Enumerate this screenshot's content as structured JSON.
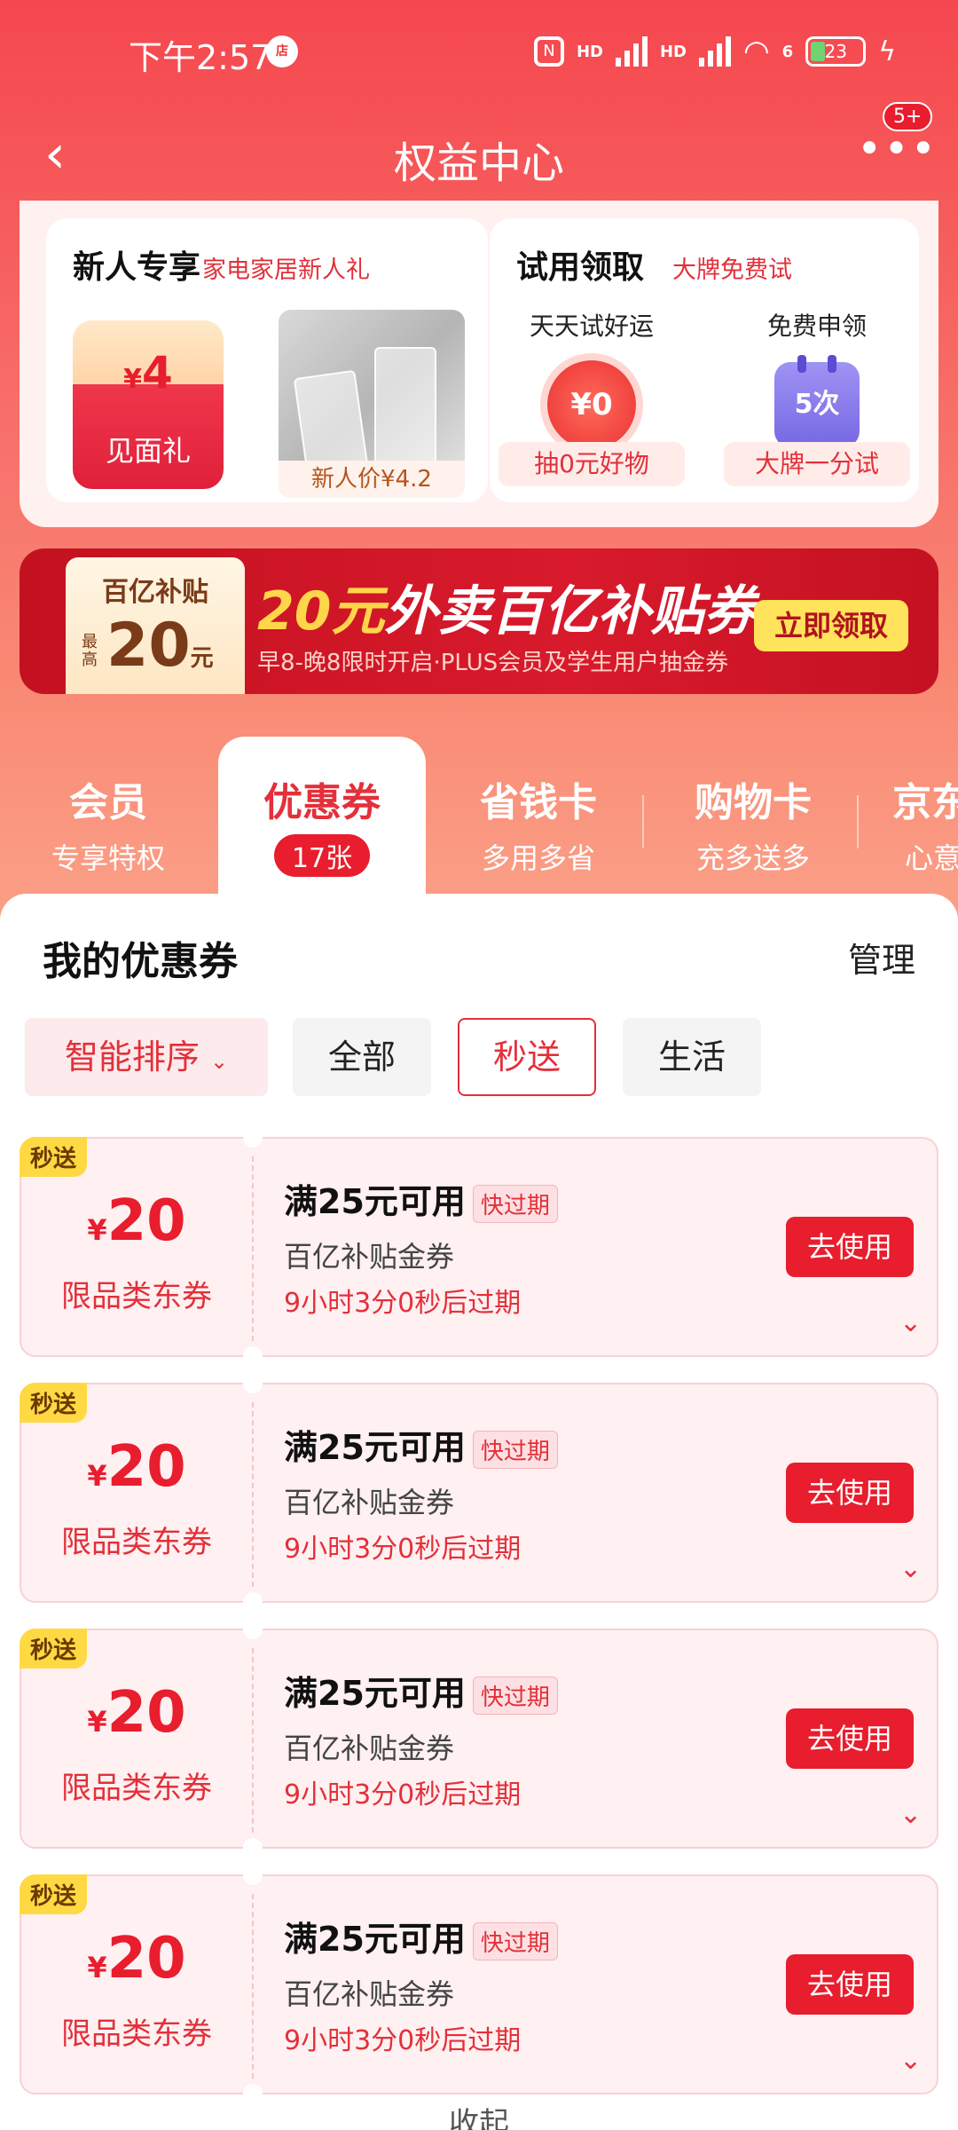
{
  "status_bar": {
    "time": "下午2:57",
    "network_1": "HD",
    "network_2": "HD",
    "wifi_badge": "6",
    "battery": "23"
  },
  "nav": {
    "title": "权益中心",
    "more_badge": "5+"
  },
  "newcomer": {
    "title": "新人专享",
    "subtitle": "家电家居新人礼",
    "coupon_currency": "¥",
    "coupon_amount": "4",
    "coupon_label": "见面礼",
    "product_price": "新人价¥4.2"
  },
  "trial": {
    "title": "试用领取",
    "subtitle": "大牌免费试",
    "col1_title": "天天试好运",
    "col1_badge": "¥0",
    "col1_button": "抽0元好物",
    "col2_title": "免费申领",
    "col2_badge": "5次",
    "col2_button": "大牌一分试"
  },
  "subsidy": {
    "ticket_title": "百亿补贴",
    "ticket_max": "最高",
    "ticket_value": "20",
    "ticket_unit": "元",
    "title_highlight": "20元",
    "title_rest": "外卖百亿补贴券",
    "description": "早8-晚8限时开启·PLUS会员及学生用户抽金券",
    "button": "立即领取"
  },
  "tabs": [
    {
      "title": "会员",
      "subtitle": "专享特权"
    },
    {
      "title": "优惠券",
      "subtitle": "17张"
    },
    {
      "title": "省钱卡",
      "subtitle": "多用多省"
    },
    {
      "title": "购物卡",
      "subtitle": "充多送多"
    },
    {
      "title": "京东",
      "subtitle": "心意"
    }
  ],
  "section": {
    "title": "我的优惠券",
    "manage": "管理"
  },
  "filters": {
    "sort": "智能排序",
    "all": "全部",
    "instant": "秒送",
    "life": "生活"
  },
  "coupons": [
    {
      "tag": "秒送",
      "currency": "¥",
      "amount": "20",
      "category": "限品类东券",
      "rule": "满25元可用",
      "expire_tag": "快过期",
      "name": "百亿补贴金券",
      "countdown": "9小时3分0秒后过期",
      "button": "去使用"
    },
    {
      "tag": "秒送",
      "currency": "¥",
      "amount": "20",
      "category": "限品类东券",
      "rule": "满25元可用",
      "expire_tag": "快过期",
      "name": "百亿补贴金券",
      "countdown": "9小时3分0秒后过期",
      "button": "去使用"
    },
    {
      "tag": "秒送",
      "currency": "¥",
      "amount": "20",
      "category": "限品类东券",
      "rule": "满25元可用",
      "expire_tag": "快过期",
      "name": "百亿补贴金券",
      "countdown": "9小时3分0秒后过期",
      "button": "去使用"
    },
    {
      "tag": "秒送",
      "currency": "¥",
      "amount": "20",
      "category": "限品类东券",
      "rule": "满25元可用",
      "expire_tag": "快过期",
      "name": "百亿补贴金券",
      "countdown": "9小时3分0秒后过期",
      "button": "去使用"
    }
  ],
  "footer": {
    "collapse": "收起"
  },
  "colors": {
    "primary": "#e81d2d",
    "header_bg": "#f5474f",
    "coupon_bg": "#fff0f1",
    "tag_yellow": "#ffd944"
  },
  "icons": [
    "back-icon",
    "more-icon",
    "chevron-down-icon",
    "wifi-icon",
    "battery-icon",
    "nfc-icon",
    "signal-icon",
    "charging-icon"
  ]
}
